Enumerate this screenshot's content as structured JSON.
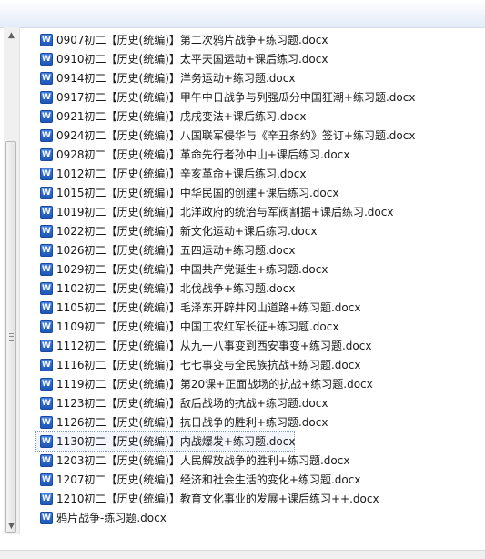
{
  "files": [
    {
      "name": "0907初二【历史(统编)】第二次鸦片战争+练习题.docx",
      "focused": false
    },
    {
      "name": "0910初二【历史(统编)】太平天国运动+课后练习.docx",
      "focused": false
    },
    {
      "name": "0914初二【历史(统编)】洋务运动+练习题.docx",
      "focused": false
    },
    {
      "name": "0917初二【历史(统编)】甲午中日战争与列强瓜分中国狂潮+练习题.docx",
      "focused": false
    },
    {
      "name": "0921初二【历史(统编)】戊戌变法+课后练习.docx",
      "focused": false
    },
    {
      "name": "0924初二【历史(统编)】八国联军侵华与《辛丑条约》签订+练习题.docx",
      "focused": false
    },
    {
      "name": "0928初二【历史(统编)】革命先行者孙中山+课后练习.docx",
      "focused": false
    },
    {
      "name": "1012初二【历史(统编)】辛亥革命+课后练习.docx",
      "focused": false
    },
    {
      "name": "1015初二【历史(统编)】中华民国的创建+课后练习.docx",
      "focused": false
    },
    {
      "name": "1019初二【历史(统编)】北洋政府的统治与军阀割据+课后练习.docx",
      "focused": false
    },
    {
      "name": "1022初二【历史(统编)】新文化运动+课后练习.docx",
      "focused": false
    },
    {
      "name": "1026初二【历史(统编)】五四运动+练习题.docx",
      "focused": false
    },
    {
      "name": "1029初二【历史(统编)】中国共产党诞生+练习题.docx",
      "focused": false
    },
    {
      "name": "1102初二【历史(统编)】北伐战争+练习题.docx",
      "focused": false
    },
    {
      "name": "1105初二【历史(统编)】毛泽东开辟井冈山道路+练习题.docx",
      "focused": false
    },
    {
      "name": "1109初二【历史(统编)】中国工农红军长征+练习题.docx",
      "focused": false
    },
    {
      "name": "1112初二【历史(统编)】从九一八事变到西安事变+练习题.docx",
      "focused": false
    },
    {
      "name": "1116初二【历史(统编)】七七事变与全民族抗战+练习题.docx",
      "focused": false
    },
    {
      "name": "1119初二【历史(统编)】第20课+正面战场的抗战+练习题.docx",
      "focused": false
    },
    {
      "name": "1123初二【历史(统编)】敌后战场的抗战+练习题.docx",
      "focused": false
    },
    {
      "name": "1126初二【历史(统编)】抗日战争的胜利+练习题.docx",
      "focused": false
    },
    {
      "name": "1130初二【历史(统编)】内战爆发+练习题.docx",
      "focused": true
    },
    {
      "name": "1203初二【历史(统编)】人民解放战争的胜利+练习题.docx",
      "focused": false
    },
    {
      "name": "1207初二【历史(统编)】经济和社会生活的变化+练习题.docx",
      "focused": false
    },
    {
      "name": "1210初二【历史(统编)】教育文化事业的发展+课后练习++.docx",
      "focused": false
    },
    {
      "name": "鸦片战争-练习题.docx",
      "focused": false
    }
  ],
  "icons": {
    "file_icon": "word-document-icon",
    "file_icon_letter": "W",
    "scroll_up": "▲",
    "scroll_down": "▼"
  },
  "colors": {
    "icon_blue": "#2a64c8",
    "focus_outline": "#7a96c8"
  }
}
